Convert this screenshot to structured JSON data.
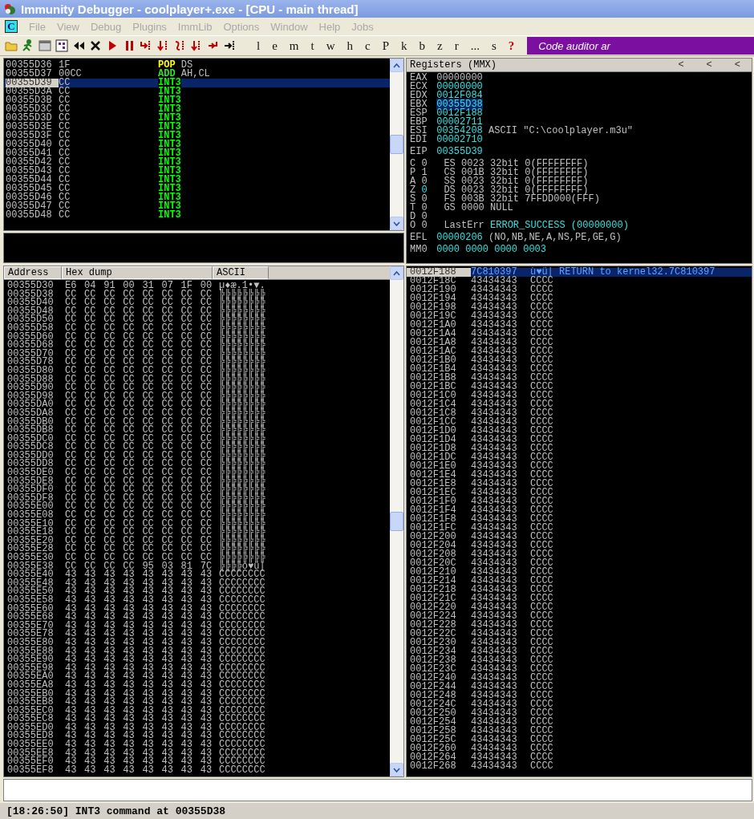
{
  "window": {
    "title": "Immunity Debugger - coolplayer+.exe - [CPU - main thread]"
  },
  "menu": {
    "app_button": "C",
    "items": [
      "File",
      "View",
      "Debug",
      "Plugins",
      "ImmLib",
      "Options",
      "Window",
      "Help",
      "Jobs"
    ]
  },
  "toolbar": {
    "letters": [
      "l",
      "e",
      "m",
      "t",
      "w",
      "h",
      "c",
      "P",
      "k",
      "b",
      "z",
      "r",
      "...",
      "s"
    ],
    "help": "?",
    "banner": "Code auditor ar"
  },
  "disasm": {
    "rows": [
      {
        "address": "00355D36",
        "hex": "1F",
        "mnemonic": "POP",
        "operands": "DS",
        "color": "#ffff00",
        "selected": false
      },
      {
        "address": "00355D37",
        "hex": "00CC",
        "mnemonic": "ADD",
        "operands": "AH,CL",
        "color": "#33dd33",
        "selected": false
      },
      {
        "address": "00355D39",
        "hex": "CC",
        "mnemonic": "INT3",
        "color": "#00ff00",
        "selected": true
      },
      {
        "address": "00355D3A",
        "hex": "CC",
        "mnemonic": "INT3",
        "color": "#00ff00",
        "selected": false
      },
      {
        "address": "00355D3B",
        "hex": "CC",
        "mnemonic": "INT3",
        "color": "#00ff00",
        "selected": false
      },
      {
        "address": "00355D3C",
        "hex": "CC",
        "mnemonic": "INT3",
        "color": "#00ff00",
        "selected": false
      },
      {
        "address": "00355D3D",
        "hex": "CC",
        "mnemonic": "INT3",
        "color": "#00ff00",
        "selected": false
      },
      {
        "address": "00355D3E",
        "hex": "CC",
        "mnemonic": "INT3",
        "color": "#00ff00",
        "selected": false
      },
      {
        "address": "00355D3F",
        "hex": "CC",
        "mnemonic": "INT3",
        "color": "#00ff00",
        "selected": false
      },
      {
        "address": "00355D40",
        "hex": "CC",
        "mnemonic": "INT3",
        "color": "#00ff00",
        "selected": false
      },
      {
        "address": "00355D41",
        "hex": "CC",
        "mnemonic": "INT3",
        "color": "#00ff00",
        "selected": false
      },
      {
        "address": "00355D42",
        "hex": "CC",
        "mnemonic": "INT3",
        "color": "#00ff00",
        "selected": false
      },
      {
        "address": "00355D43",
        "hex": "CC",
        "mnemonic": "INT3",
        "color": "#00ff00",
        "selected": false
      },
      {
        "address": "00355D44",
        "hex": "CC",
        "mnemonic": "INT3",
        "color": "#00ff00",
        "selected": false
      },
      {
        "address": "00355D45",
        "hex": "CC",
        "mnemonic": "INT3",
        "color": "#00ff00",
        "selected": false
      },
      {
        "address": "00355D46",
        "hex": "CC",
        "mnemonic": "INT3",
        "color": "#00ff00",
        "selected": false
      },
      {
        "address": "00355D47",
        "hex": "CC",
        "mnemonic": "INT3",
        "color": "#00ff00",
        "selected": false
      },
      {
        "address": "00355D48",
        "hex": "CC",
        "mnemonic": "INT3",
        "color": "#00ff00",
        "selected": false
      }
    ]
  },
  "registers": {
    "title": "Registers (MMX)",
    "header_buttons": [
      "<",
      "<",
      "<"
    ],
    "groups": [
      [
        {
          "kind": "reg",
          "name": "EAX",
          "value": "00000000",
          "changed": false,
          "selected": false
        },
        {
          "kind": "reg",
          "name": "ECX",
          "value": "00000000",
          "changed": true,
          "selected": false
        },
        {
          "kind": "reg",
          "name": "EDX",
          "value": "0012F084",
          "changed": true,
          "selected": false
        },
        {
          "kind": "reg",
          "name": "EBX",
          "value": "00355D38",
          "changed": true,
          "selected": true
        },
        {
          "kind": "reg",
          "name": "ESP",
          "value": "0012F188",
          "changed": true,
          "selected": false
        },
        {
          "kind": "reg",
          "name": "EBP",
          "value": "00002711",
          "changed": true,
          "selected": false
        },
        {
          "kind": "reg",
          "name": "ESI",
          "value": "00354208",
          "changed": true,
          "selected": false,
          "comment": "ASCII \"C:\\coolplayer.m3u\""
        },
        {
          "kind": "reg",
          "name": "EDI",
          "value": "00002710",
          "changed": true,
          "selected": false
        }
      ],
      [
        {
          "kind": "reg",
          "name": "EIP",
          "value": "00355D39",
          "changed": true,
          "selected": false
        }
      ],
      [
        {
          "kind": "flag",
          "name": "C",
          "value": "0",
          "changed": false,
          "segment": "ES 0023 32bit 0(FFFFFFFF)"
        },
        {
          "kind": "flag",
          "name": "P",
          "value": "1",
          "changed": false,
          "segment": "CS 001B 32bit 0(FFFFFFFF)"
        },
        {
          "kind": "flag",
          "name": "A",
          "value": "0",
          "changed": false,
          "segment": "SS 0023 32bit 0(FFFFFFFF)"
        },
        {
          "kind": "flag",
          "name": "Z",
          "value": "0",
          "changed": true,
          "segment": "DS 0023 32bit 0(FFFFFFFF)"
        },
        {
          "kind": "flag",
          "name": "S",
          "value": "0",
          "changed": false,
          "segment": "FS 003B 32bit 7FFDD000(FFF)"
        },
        {
          "kind": "flag",
          "name": "T",
          "value": "0",
          "changed": false,
          "segment": "GS 0000 NULL"
        },
        {
          "kind": "flag",
          "name": "D",
          "value": "0",
          "changed": false
        },
        {
          "kind": "lasterr",
          "name": "O",
          "value": "0",
          "changed": false,
          "label": "LastErr",
          "text": "ERROR_SUCCESS (00000000)"
        }
      ],
      [
        {
          "kind": "reg",
          "name": "EFL",
          "value": "00000206",
          "changed": true,
          "selected": false,
          "comment": "(NO,NB,NE,A,NS,PE,GE,G)"
        }
      ],
      [
        {
          "kind": "reg",
          "name": "MM0",
          "value": "0000 0000 0000 0003",
          "changed": true,
          "selected": false
        }
      ]
    ]
  },
  "dump": {
    "columns": [
      "Address",
      "Hex dump",
      "ASCII"
    ],
    "rows": [
      {
        "address": "00355D30",
        "hex": "E6 04 91 00 31 07 1F 00",
        "ascii": "µ♦æ.1•▼."
      },
      {
        "address": "00355D38",
        "hex": "CC CC CC CC CC CC CC CC",
        "ascii": "╠╠╠╠╠╠╠╠"
      },
      {
        "address": "00355D40",
        "hex": "CC CC CC CC CC CC CC CC",
        "ascii": "╠╠╠╠╠╠╠╠"
      },
      {
        "address": "00355D48",
        "hex": "CC CC CC CC CC CC CC CC",
        "ascii": "╠╠╠╠╠╠╠╠"
      },
      {
        "address": "00355D50",
        "hex": "CC CC CC CC CC CC CC CC",
        "ascii": "╠╠╠╠╠╠╠╠"
      },
      {
        "address": "00355D58",
        "hex": "CC CC CC CC CC CC CC CC",
        "ascii": "╠╠╠╠╠╠╠╠"
      },
      {
        "address": "00355D60",
        "hex": "CC CC CC CC CC CC CC CC",
        "ascii": "╠╠╠╠╠╠╠╠"
      },
      {
        "address": "00355D68",
        "hex": "CC CC CC CC CC CC CC CC",
        "ascii": "╠╠╠╠╠╠╠╠"
      },
      {
        "address": "00355D70",
        "hex": "CC CC CC CC CC CC CC CC",
        "ascii": "╠╠╠╠╠╠╠╠"
      },
      {
        "address": "00355D78",
        "hex": "CC CC CC CC CC CC CC CC",
        "ascii": "╠╠╠╠╠╠╠╠"
      },
      {
        "address": "00355D80",
        "hex": "CC CC CC CC CC CC CC CC",
        "ascii": "╠╠╠╠╠╠╠╠"
      },
      {
        "address": "00355D88",
        "hex": "CC CC CC CC CC CC CC CC",
        "ascii": "╠╠╠╠╠╠╠╠"
      },
      {
        "address": "00355D90",
        "hex": "CC CC CC CC CC CC CC CC",
        "ascii": "╠╠╠╠╠╠╠╠"
      },
      {
        "address": "00355D98",
        "hex": "CC CC CC CC CC CC CC CC",
        "ascii": "╠╠╠╠╠╠╠╠"
      },
      {
        "address": "00355DA0",
        "hex": "CC CC CC CC CC CC CC CC",
        "ascii": "╠╠╠╠╠╠╠╠"
      },
      {
        "address": "00355DA8",
        "hex": "CC CC CC CC CC CC CC CC",
        "ascii": "╠╠╠╠╠╠╠╠"
      },
      {
        "address": "00355DB0",
        "hex": "CC CC CC CC CC CC CC CC",
        "ascii": "╠╠╠╠╠╠╠╠"
      },
      {
        "address": "00355DB8",
        "hex": "CC CC CC CC CC CC CC CC",
        "ascii": "╠╠╠╠╠╠╠╠"
      },
      {
        "address": "00355DC0",
        "hex": "CC CC CC CC CC CC CC CC",
        "ascii": "╠╠╠╠╠╠╠╠"
      },
      {
        "address": "00355DC8",
        "hex": "CC CC CC CC CC CC CC CC",
        "ascii": "╠╠╠╠╠╠╠╠"
      },
      {
        "address": "00355DD0",
        "hex": "CC CC CC CC CC CC CC CC",
        "ascii": "╠╠╠╠╠╠╠╠"
      },
      {
        "address": "00355DD8",
        "hex": "CC CC CC CC CC CC CC CC",
        "ascii": "╠╠╠╠╠╠╠╠"
      },
      {
        "address": "00355DE0",
        "hex": "CC CC CC CC CC CC CC CC",
        "ascii": "╠╠╠╠╠╠╠╠"
      },
      {
        "address": "00355DE8",
        "hex": "CC CC CC CC CC CC CC CC",
        "ascii": "╠╠╠╠╠╠╠╠"
      },
      {
        "address": "00355DF0",
        "hex": "CC CC CC CC CC CC CC CC",
        "ascii": "╠╠╠╠╠╠╠╠"
      },
      {
        "address": "00355DF8",
        "hex": "CC CC CC CC CC CC CC CC",
        "ascii": "╠╠╠╠╠╠╠╠"
      },
      {
        "address": "00355E00",
        "hex": "CC CC CC CC CC CC CC CC",
        "ascii": "╠╠╠╠╠╠╠╠"
      },
      {
        "address": "00355E08",
        "hex": "CC CC CC CC CC CC CC CC",
        "ascii": "╠╠╠╠╠╠╠╠"
      },
      {
        "address": "00355E10",
        "hex": "CC CC CC CC CC CC CC CC",
        "ascii": "╠╠╠╠╠╠╠╠"
      },
      {
        "address": "00355E18",
        "hex": "CC CC CC CC CC CC CC CC",
        "ascii": "╠╠╠╠╠╠╠╠"
      },
      {
        "address": "00355E20",
        "hex": "CC CC CC CC CC CC CC CC",
        "ascii": "╠╠╠╠╠╠╠╠"
      },
      {
        "address": "00355E28",
        "hex": "CC CC CC CC CC CC CC CC",
        "ascii": "╠╠╠╠╠╠╠╠"
      },
      {
        "address": "00355E30",
        "hex": "CC CC CC CC CC CC CC CC",
        "ascii": "╠╠╠╠╠╠╠╠"
      },
      {
        "address": "00355E38",
        "hex": "CC CC CC CC 95 03 81 7C",
        "ascii": "╠╠╠╠ò♥ü|"
      },
      {
        "address": "00355E40",
        "hex": "43 43 43 43 43 43 43 43",
        "ascii": "CCCCCCCC"
      },
      {
        "address": "00355E48",
        "hex": "43 43 43 43 43 43 43 43",
        "ascii": "CCCCCCCC"
      },
      {
        "address": "00355E50",
        "hex": "43 43 43 43 43 43 43 43",
        "ascii": "CCCCCCCC"
      },
      {
        "address": "00355E58",
        "hex": "43 43 43 43 43 43 43 43",
        "ascii": "CCCCCCCC"
      },
      {
        "address": "00355E60",
        "hex": "43 43 43 43 43 43 43 43",
        "ascii": "CCCCCCCC"
      },
      {
        "address": "00355E68",
        "hex": "43 43 43 43 43 43 43 43",
        "ascii": "CCCCCCCC"
      },
      {
        "address": "00355E70",
        "hex": "43 43 43 43 43 43 43 43",
        "ascii": "CCCCCCCC"
      },
      {
        "address": "00355E78",
        "hex": "43 43 43 43 43 43 43 43",
        "ascii": "CCCCCCCC"
      },
      {
        "address": "00355E80",
        "hex": "43 43 43 43 43 43 43 43",
        "ascii": "CCCCCCCC"
      },
      {
        "address": "00355E88",
        "hex": "43 43 43 43 43 43 43 43",
        "ascii": "CCCCCCCC"
      },
      {
        "address": "00355E90",
        "hex": "43 43 43 43 43 43 43 43",
        "ascii": "CCCCCCCC"
      },
      {
        "address": "00355E98",
        "hex": "43 43 43 43 43 43 43 43",
        "ascii": "CCCCCCCC"
      },
      {
        "address": "00355EA0",
        "hex": "43 43 43 43 43 43 43 43",
        "ascii": "CCCCCCCC"
      },
      {
        "address": "00355EA8",
        "hex": "43 43 43 43 43 43 43 43",
        "ascii": "CCCCCCCC"
      },
      {
        "address": "00355EB0",
        "hex": "43 43 43 43 43 43 43 43",
        "ascii": "CCCCCCCC"
      },
      {
        "address": "00355EB8",
        "hex": "43 43 43 43 43 43 43 43",
        "ascii": "CCCCCCCC"
      },
      {
        "address": "00355EC0",
        "hex": "43 43 43 43 43 43 43 43",
        "ascii": "CCCCCCCC"
      },
      {
        "address": "00355EC8",
        "hex": "43 43 43 43 43 43 43 43",
        "ascii": "CCCCCCCC"
      },
      {
        "address": "00355ED0",
        "hex": "43 43 43 43 43 43 43 43",
        "ascii": "CCCCCCCC"
      },
      {
        "address": "00355ED8",
        "hex": "43 43 43 43 43 43 43 43",
        "ascii": "CCCCCCCC"
      },
      {
        "address": "00355EE0",
        "hex": "43 43 43 43 43 43 43 43",
        "ascii": "CCCCCCCC"
      },
      {
        "address": "00355EE8",
        "hex": "43 43 43 43 43 43 43 43",
        "ascii": "CCCCCCCC"
      },
      {
        "address": "00355EF0",
        "hex": "43 43 43 43 43 43 43 43",
        "ascii": "CCCCCCCC"
      },
      {
        "address": "00355EF8",
        "hex": "43 43 43 43 43 43 43 43",
        "ascii": "CCCCCCCC"
      }
    ]
  },
  "stack": {
    "rows": [
      {
        "address": "0012F188",
        "value": "7C810397",
        "comment": "ù♥ü| RETURN to kernel32.7C810397",
        "selected": true
      },
      {
        "address": "0012F18C",
        "value": "43434343",
        "comment": "CCCC",
        "selected": false
      },
      {
        "address": "0012F190",
        "value": "43434343",
        "comment": "CCCC",
        "selected": false
      },
      {
        "address": "0012F194",
        "value": "43434343",
        "comment": "CCCC",
        "selected": false
      },
      {
        "address": "0012F198",
        "value": "43434343",
        "comment": "CCCC",
        "selected": false
      },
      {
        "address": "0012F19C",
        "value": "43434343",
        "comment": "CCCC",
        "selected": false
      },
      {
        "address": "0012F1A0",
        "value": "43434343",
        "comment": "CCCC",
        "selected": false
      },
      {
        "address": "0012F1A4",
        "value": "43434343",
        "comment": "CCCC",
        "selected": false
      },
      {
        "address": "0012F1A8",
        "value": "43434343",
        "comment": "CCCC",
        "selected": false
      },
      {
        "address": "0012F1AC",
        "value": "43434343",
        "comment": "CCCC",
        "selected": false
      },
      {
        "address": "0012F1B0",
        "value": "43434343",
        "comment": "CCCC",
        "selected": false
      },
      {
        "address": "0012F1B4",
        "value": "43434343",
        "comment": "CCCC",
        "selected": false
      },
      {
        "address": "0012F1B8",
        "value": "43434343",
        "comment": "CCCC",
        "selected": false
      },
      {
        "address": "0012F1BC",
        "value": "43434343",
        "comment": "CCCC",
        "selected": false
      },
      {
        "address": "0012F1C0",
        "value": "43434343",
        "comment": "CCCC",
        "selected": false
      },
      {
        "address": "0012F1C4",
        "value": "43434343",
        "comment": "CCCC",
        "selected": false
      },
      {
        "address": "0012F1C8",
        "value": "43434343",
        "comment": "CCCC",
        "selected": false
      },
      {
        "address": "0012F1CC",
        "value": "43434343",
        "comment": "CCCC",
        "selected": false
      },
      {
        "address": "0012F1D0",
        "value": "43434343",
        "comment": "CCCC",
        "selected": false
      },
      {
        "address": "0012F1D4",
        "value": "43434343",
        "comment": "CCCC",
        "selected": false
      },
      {
        "address": "0012F1D8",
        "value": "43434343",
        "comment": "CCCC",
        "selected": false
      },
      {
        "address": "0012F1DC",
        "value": "43434343",
        "comment": "CCCC",
        "selected": false
      },
      {
        "address": "0012F1E0",
        "value": "43434343",
        "comment": "CCCC",
        "selected": false
      },
      {
        "address": "0012F1E4",
        "value": "43434343",
        "comment": "CCCC",
        "selected": false
      },
      {
        "address": "0012F1E8",
        "value": "43434343",
        "comment": "CCCC",
        "selected": false
      },
      {
        "address": "0012F1EC",
        "value": "43434343",
        "comment": "CCCC",
        "selected": false
      },
      {
        "address": "0012F1F0",
        "value": "43434343",
        "comment": "CCCC",
        "selected": false
      },
      {
        "address": "0012F1F4",
        "value": "43434343",
        "comment": "CCCC",
        "selected": false
      },
      {
        "address": "0012F1F8",
        "value": "43434343",
        "comment": "CCCC",
        "selected": false
      },
      {
        "address": "0012F1FC",
        "value": "43434343",
        "comment": "CCCC",
        "selected": false
      },
      {
        "address": "0012F200",
        "value": "43434343",
        "comment": "CCCC",
        "selected": false
      },
      {
        "address": "0012F204",
        "value": "43434343",
        "comment": "CCCC",
        "selected": false
      },
      {
        "address": "0012F208",
        "value": "43434343",
        "comment": "CCCC",
        "selected": false
      },
      {
        "address": "0012F20C",
        "value": "43434343",
        "comment": "CCCC",
        "selected": false
      },
      {
        "address": "0012F210",
        "value": "43434343",
        "comment": "CCCC",
        "selected": false
      },
      {
        "address": "0012F214",
        "value": "43434343",
        "comment": "CCCC",
        "selected": false
      },
      {
        "address": "0012F218",
        "value": "43434343",
        "comment": "CCCC",
        "selected": false
      },
      {
        "address": "0012F21C",
        "value": "43434343",
        "comment": "CCCC",
        "selected": false
      },
      {
        "address": "0012F220",
        "value": "43434343",
        "comment": "CCCC",
        "selected": false
      },
      {
        "address": "0012F224",
        "value": "43434343",
        "comment": "CCCC",
        "selected": false
      },
      {
        "address": "0012F228",
        "value": "43434343",
        "comment": "CCCC",
        "selected": false
      },
      {
        "address": "0012F22C",
        "value": "43434343",
        "comment": "CCCC",
        "selected": false
      },
      {
        "address": "0012F230",
        "value": "43434343",
        "comment": "CCCC",
        "selected": false
      },
      {
        "address": "0012F234",
        "value": "43434343",
        "comment": "CCCC",
        "selected": false
      },
      {
        "address": "0012F238",
        "value": "43434343",
        "comment": "CCCC",
        "selected": false
      },
      {
        "address": "0012F23C",
        "value": "43434343",
        "comment": "CCCC",
        "selected": false
      },
      {
        "address": "0012F240",
        "value": "43434343",
        "comment": "CCCC",
        "selected": false
      },
      {
        "address": "0012F244",
        "value": "43434343",
        "comment": "CCCC",
        "selected": false
      },
      {
        "address": "0012F248",
        "value": "43434343",
        "comment": "CCCC",
        "selected": false
      },
      {
        "address": "0012F24C",
        "value": "43434343",
        "comment": "CCCC",
        "selected": false
      },
      {
        "address": "0012F250",
        "value": "43434343",
        "comment": "CCCC",
        "selected": false
      },
      {
        "address": "0012F254",
        "value": "43434343",
        "comment": "CCCC",
        "selected": false
      },
      {
        "address": "0012F258",
        "value": "43434343",
        "comment": "CCCC",
        "selected": false
      },
      {
        "address": "0012F25C",
        "value": "43434343",
        "comment": "CCCC",
        "selected": false
      },
      {
        "address": "0012F260",
        "value": "43434343",
        "comment": "CCCC",
        "selected": false
      },
      {
        "address": "0012F264",
        "value": "43434343",
        "comment": "CCCC",
        "selected": false
      },
      {
        "address": "0012F268",
        "value": "43434343",
        "comment": "CCCC",
        "selected": false
      }
    ]
  },
  "status_bar": {
    "text": "[18:26:50] INT3 command at 00355D38"
  }
}
